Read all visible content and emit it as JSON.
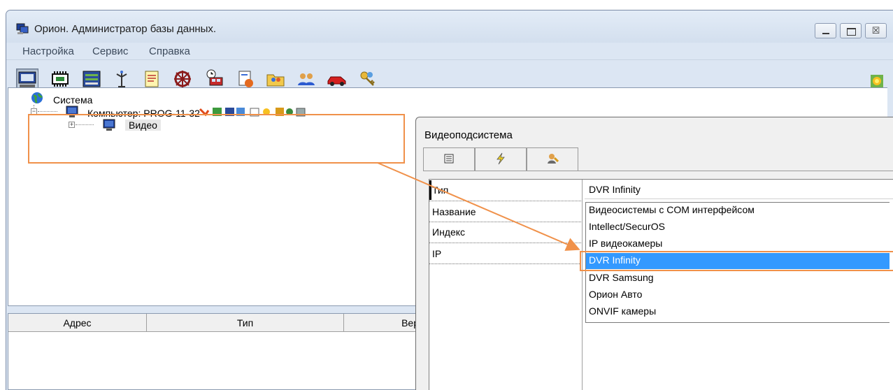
{
  "window": {
    "title": "Орион. Администратор базы данных.",
    "icon": "computer-app-icon",
    "controls": [
      "minimize",
      "maximize",
      "close"
    ],
    "close_glyph": "☒"
  },
  "menu": {
    "items": [
      "Настройка",
      "Сервис",
      "Справка"
    ]
  },
  "toolbar": {
    "buttons": [
      "computers-icon",
      "devices-icon",
      "panels-icon",
      "antenna-icon",
      "notes-icon",
      "wheel-icon",
      "train-schedule-icon",
      "doc-icon",
      "folder-people-icon",
      "users-icon",
      "car-icon",
      "keys-icon"
    ],
    "right_icon": "sun-icon"
  },
  "tree": {
    "root_label": "Система",
    "computer_label": "Компьютер: PROG-11-32",
    "video_label": "Видео",
    "expander_minus": "−",
    "expander_plus": "+"
  },
  "table": {
    "columns": [
      "Адрес",
      "Тип",
      "Верс"
    ]
  },
  "video_panel": {
    "title": "Видеоподсистема",
    "tabs": [
      "list-icon",
      "lightning-icon",
      "user-settings-icon"
    ],
    "properties": [
      "Тип",
      "Название",
      "Индекс",
      "IP"
    ],
    "type_value": "DVR Infinity",
    "dropdown_options": [
      "Видеосистемы с COM интерфейсом",
      "Intellect/SecurOS",
      "IP видеокамеры",
      "DVR Infinity",
      "DVR Samsung",
      "Орион Авто",
      "ONVIF камеры"
    ],
    "selected_option": "DVR Infinity"
  },
  "colors": {
    "highlight_orange": "#f0914a",
    "selection_blue": "#3399ff",
    "window_bg": "#dce6f3"
  }
}
